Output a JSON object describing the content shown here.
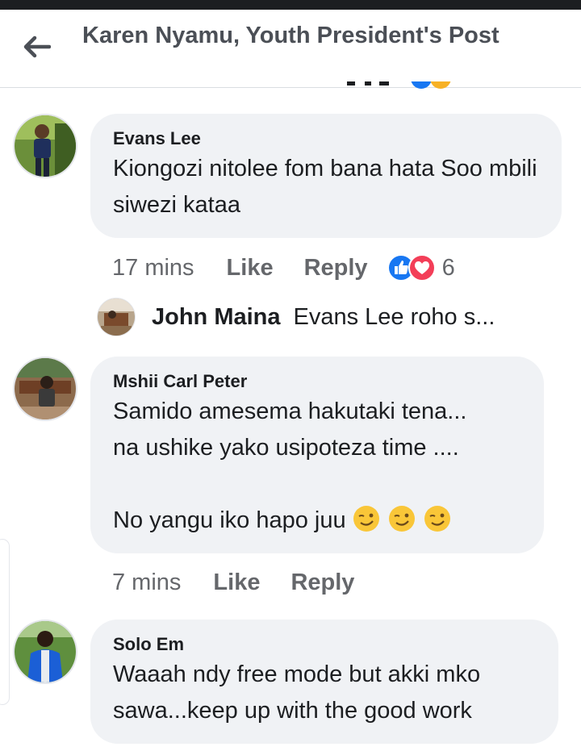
{
  "header": {
    "title": "Karen Nyamu, Youth President's Post"
  },
  "comments": [
    {
      "author": "Evans Lee",
      "text": "Kiongozi nitolee fom bana hata Soo mbili siwezi kataa",
      "time": "17 mins",
      "like_label": "Like",
      "reply_label": "Reply",
      "reaction_count": "6",
      "reactions": [
        "like-reaction-icon",
        "love-reaction-icon"
      ]
    },
    {
      "author": "Mshii Carl Peter",
      "text": "Samido amesema hakutaki tena...\nna ushike yako usipoteza time ....\n\nNo yangu iko hapo juu",
      "time": "7 mins",
      "like_label": "Like",
      "reply_label": "Reply"
    },
    {
      "author": "Solo Em",
      "text": "Waaah ndy free mode but akki mko sawa...keep up with the good work"
    }
  ],
  "reply_preview": {
    "author": "John Maina",
    "text": "Evans Lee roho s..."
  },
  "colors": {
    "bubble": "#f0f2f5",
    "like_blue": "#1877f2",
    "love_red": "#f33e58",
    "muted_text": "#65676b"
  }
}
